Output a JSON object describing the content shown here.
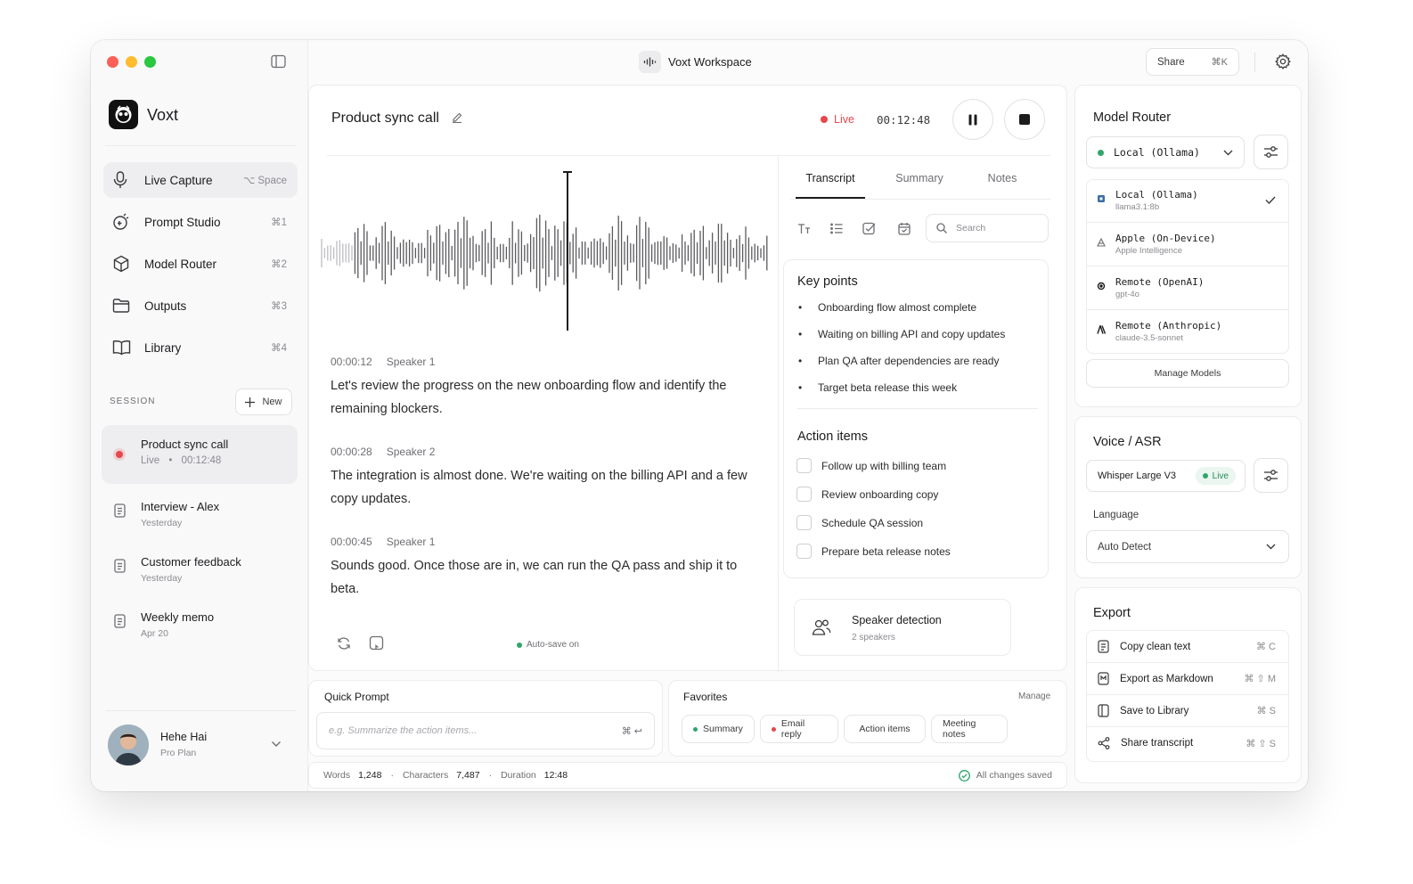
{
  "window": {
    "title": "Voxt Workspace",
    "share_label": "Share",
    "share_shortcut": "⌘K"
  },
  "app": {
    "name": "Voxt"
  },
  "nav": [
    {
      "label": "Live Capture",
      "shortcut": "⌥ Space",
      "icon": "mic-icon"
    },
    {
      "label": "Prompt Studio",
      "shortcut": "⌘1",
      "icon": "prompt-icon"
    },
    {
      "label": "Model Router",
      "shortcut": "⌘2",
      "icon": "cube-icon"
    },
    {
      "label": "Outputs",
      "shortcut": "⌘3",
      "icon": "folder-icon"
    },
    {
      "label": "Library",
      "shortcut": "⌘4",
      "icon": "book-icon"
    }
  ],
  "session": {
    "header": "SESSION",
    "new_label": "New",
    "items": [
      {
        "title": "Product sync call",
        "status": "Live",
        "time": "00:12:48"
      },
      {
        "title": "Interview - Alex",
        "sub": "Yesterday"
      },
      {
        "title": "Customer feedback",
        "sub": "Yesterday"
      },
      {
        "title": "Weekly memo",
        "sub": "Apr 20"
      }
    ]
  },
  "user": {
    "name": "Hehe Hai",
    "plan": "Pro Plan"
  },
  "recording": {
    "title": "Product sync call",
    "status": "Live",
    "elapsed": "00:12:48",
    "autosave": "Auto-save on"
  },
  "transcript": [
    {
      "time": "00:00:12",
      "speaker": "Speaker 1",
      "text": "Let's review the progress on the new onboarding flow and identify the remaining blockers."
    },
    {
      "time": "00:00:28",
      "speaker": "Speaker 2",
      "text": "The integration is almost done. We're waiting on the billing API and a few copy updates."
    },
    {
      "time": "00:00:45",
      "speaker": "Speaker 1",
      "text": "Sounds good. Once those are in, we can run the QA pass and ship it to beta."
    }
  ],
  "tabs": [
    "Transcript",
    "Summary",
    "Notes"
  ],
  "search_placeholder": "Search",
  "key_points": {
    "title": "Key points",
    "items": [
      "Onboarding flow almost complete",
      "Waiting on billing API and copy updates",
      "Plan QA after dependencies are ready",
      "Target beta release this week"
    ]
  },
  "action_items": {
    "title": "Action items",
    "items": [
      "Follow up with billing team",
      "Review onboarding copy",
      "Schedule QA session",
      "Prepare beta release notes"
    ]
  },
  "speaker_detection": {
    "title": "Speaker detection",
    "sub": "2 speakers"
  },
  "quick_prompt": {
    "title": "Quick Prompt",
    "placeholder": "e.g. Summarize the action items...",
    "shortcut": "⌘ ↩"
  },
  "favorites": {
    "title": "Favorites",
    "manage": "Manage",
    "chips": [
      "Summary",
      "Email reply",
      "Action items",
      "Meeting notes"
    ]
  },
  "stats": {
    "words_label": "Words",
    "words": "1,248",
    "chars_label": "Characters",
    "chars": "7,487",
    "duration_label": "Duration",
    "duration": "12:48",
    "saved": "All changes saved"
  },
  "model_router": {
    "title": "Model Router",
    "selected": "Local (Ollama)",
    "models": [
      {
        "name": "Local (Ollama)",
        "detail": "llama3.1:8b"
      },
      {
        "name": "Apple (On-Device)",
        "detail": "Apple Intelligence"
      },
      {
        "name": "Remote (OpenAI)",
        "detail": "gpt-4o"
      },
      {
        "name": "Remote (Anthropic)",
        "detail": "claude-3.5-sonnet"
      }
    ],
    "manage_label": "Manage Models"
  },
  "voice": {
    "title": "Voice / ASR",
    "model": "Whisper Large V3",
    "status": "Live",
    "language_label": "Language",
    "language": "Auto Detect"
  },
  "export": {
    "title": "Export",
    "items": [
      {
        "label": "Copy clean text",
        "shortcut": "⌘ C"
      },
      {
        "label": "Export as Markdown",
        "shortcut": "⌘ ⇧ M"
      },
      {
        "label": "Save to Library",
        "shortcut": "⌘ S"
      },
      {
        "label": "Share transcript",
        "shortcut": "⌘ ⇧ S"
      }
    ]
  },
  "colors": {
    "live_red": "#e5484d",
    "ok_green": "#30a46c",
    "accent": "#1c1c1e"
  }
}
